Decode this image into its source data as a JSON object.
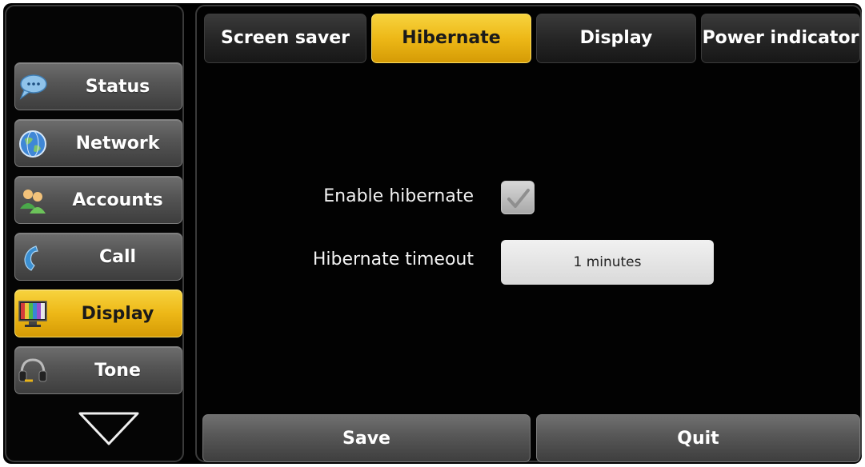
{
  "sidebar": {
    "items": [
      {
        "label": "Status",
        "icon": "speech-bubble-icon"
      },
      {
        "label": "Network",
        "icon": "globe-icon"
      },
      {
        "label": "Accounts",
        "icon": "users-icon"
      },
      {
        "label": "Call",
        "icon": "phone-handset-icon"
      },
      {
        "label": "Display",
        "icon": "monitor-icon",
        "active": true
      },
      {
        "label": "Tone",
        "icon": "headset-icon"
      }
    ],
    "scroll_icon": "chevron-down-icon"
  },
  "tabs": [
    {
      "label": "Screen saver"
    },
    {
      "label": "Hibernate",
      "active": true
    },
    {
      "label": "Display"
    },
    {
      "label": "Power indicator"
    }
  ],
  "form": {
    "enable_hibernate_label": "Enable hibernate",
    "enable_hibernate_checked": true,
    "timeout_label": "Hibernate timeout",
    "timeout_value": "1 minutes"
  },
  "actions": {
    "save_label": "Save",
    "quit_label": "Quit"
  },
  "colors": {
    "accent": "#edb817",
    "background": "#000000",
    "button": "#575757"
  }
}
